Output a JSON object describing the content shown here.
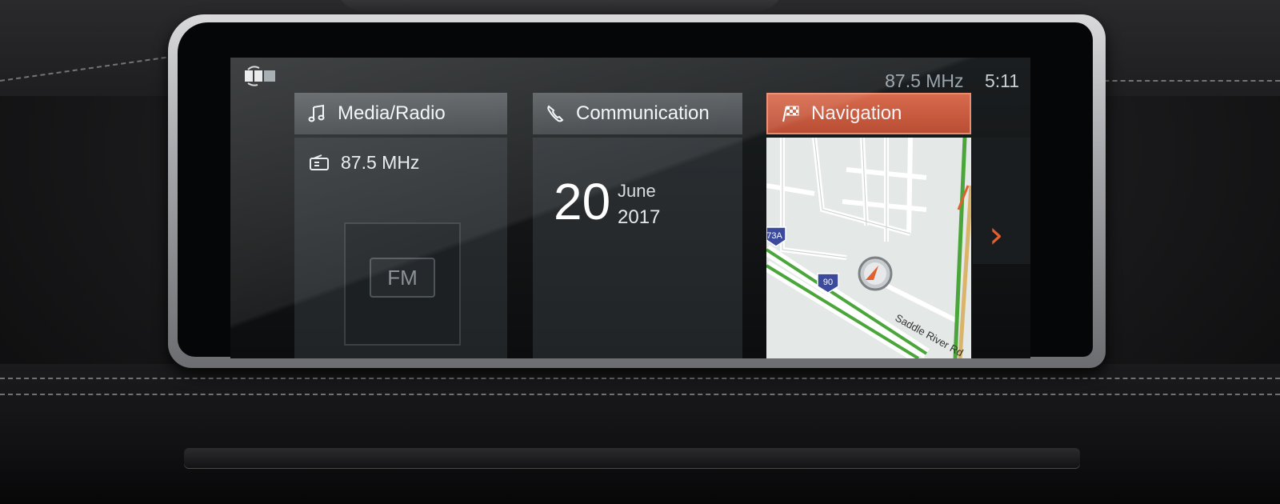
{
  "status_bar": {
    "frequency": "87.5 MHz",
    "time": "5:11"
  },
  "tiles": [
    {
      "title": "Media/Radio",
      "icon": "music-note-icon",
      "station": "87.5 MHz",
      "station_icon": "radio-icon",
      "band": "FM"
    },
    {
      "title": "Communication",
      "icon": "phone-icon",
      "day": "20",
      "month": "June",
      "year": "2017"
    },
    {
      "title": "Navigation",
      "icon": "checkered-flag-icon",
      "route_shield_1": "73A",
      "route_shield_2": "90",
      "road_label": "Saddle River Rd"
    }
  ],
  "next_arrow": "›",
  "colors": {
    "accent": "#c9583c",
    "arrow": "#e2602f",
    "route": "#4aa63a"
  }
}
